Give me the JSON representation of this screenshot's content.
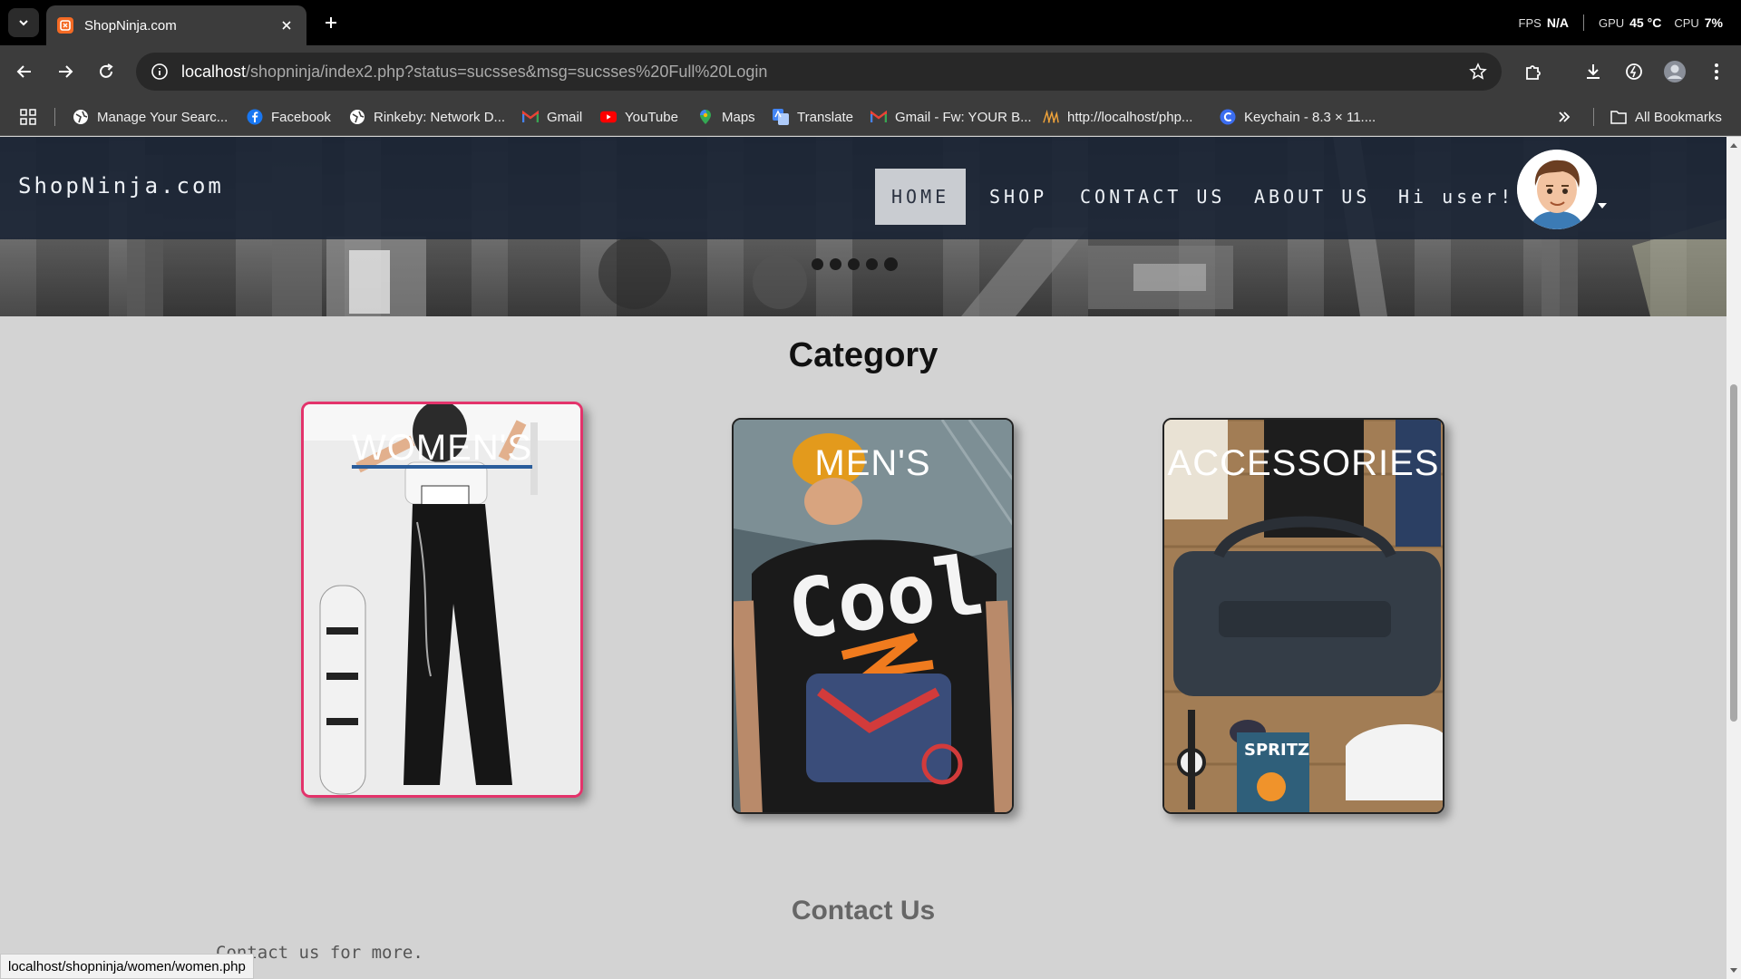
{
  "browser": {
    "tab_title": "ShopNinja.com",
    "url_host": "localhost",
    "url_path": "/shopninja/index2.php?status=sucsses&msg=sucsses%20Full%20Login",
    "status_url": "localhost/shopninja/women/women.php",
    "perf": {
      "fps_label": "FPS",
      "fps_value": "N/A",
      "gpu_label": "GPU",
      "gpu_value": "45 °C",
      "cpu_label": "CPU",
      "cpu_value": "7%"
    },
    "bookmarks": [
      {
        "label": "Manage Your Searc...",
        "icon": "globe-icon"
      },
      {
        "label": "Facebook",
        "icon": "facebook-icon"
      },
      {
        "label": "Rinkeby: Network D...",
        "icon": "globe-icon"
      },
      {
        "label": "Gmail",
        "icon": "gmail-icon"
      },
      {
        "label": "YouTube",
        "icon": "youtube-icon"
      },
      {
        "label": "Maps",
        "icon": "maps-icon"
      },
      {
        "label": "Translate",
        "icon": "translate-icon"
      },
      {
        "label": "Gmail - Fw: YOUR B...",
        "icon": "gmail-icon"
      },
      {
        "label": "http://localhost/php...",
        "icon": "phpmyadmin-icon"
      },
      {
        "label": "Keychain - 8.3 × 11....",
        "icon": "keychain-icon"
      }
    ],
    "all_bookmarks": "All Bookmarks"
  },
  "site": {
    "brand": "ShopNinja.com",
    "nav": {
      "home": "HOME",
      "shop": "SHOP",
      "contact": "CONTACT US",
      "about": "ABOUT US",
      "greeting": "Hi user!"
    },
    "slider_dots": 5,
    "category_title": "Category",
    "categories": [
      {
        "label": "WOMEN'S"
      },
      {
        "label": "MEN'S"
      },
      {
        "label": "ACCESSORIES"
      }
    ],
    "contact_title": "Contact Us",
    "contact_sub": "Contact us for more."
  },
  "colors": {
    "navbar": "#192334",
    "page_bg": "#d3d3d3",
    "hover_border": "#e3336b",
    "active_nav": "#c9ccd1"
  }
}
